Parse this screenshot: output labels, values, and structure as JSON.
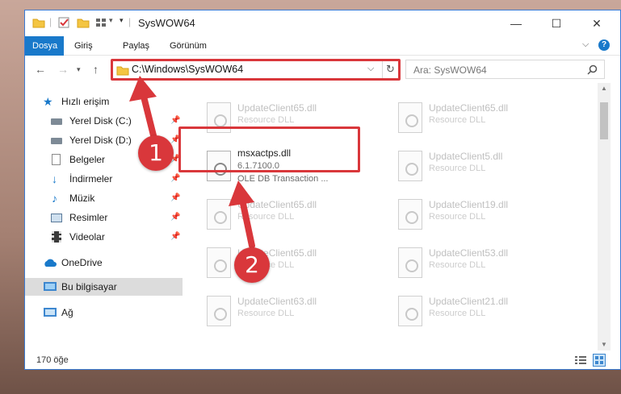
{
  "window": {
    "title": "SysWOW64",
    "controls": {
      "minimize": "—",
      "maximize": "☐",
      "close": "✕"
    }
  },
  "ribbon": {
    "tabs": [
      {
        "label": "Dosya",
        "active": true
      },
      {
        "label": "Giriş",
        "active": false
      },
      {
        "label": "Paylaş",
        "active": false
      },
      {
        "label": "Görünüm",
        "active": false
      }
    ]
  },
  "nav": {
    "address": "C:\\Windows\\SysWOW64",
    "search_placeholder": "Ara: SysWOW64"
  },
  "sidebar": {
    "items": [
      {
        "label": "Hızlı erişim",
        "icon": "star-icon"
      },
      {
        "label": "Yerel Disk (C:)",
        "icon": "drive-icon",
        "pinned": true
      },
      {
        "label": "Yerel Disk (D:)",
        "icon": "drive-icon",
        "pinned": true
      },
      {
        "label": "Belgeler",
        "icon": "documents-icon",
        "pinned": true
      },
      {
        "label": "İndirmeler",
        "icon": "download-icon",
        "pinned": true
      },
      {
        "label": "Müzik",
        "icon": "music-icon",
        "pinned": true
      },
      {
        "label": "Resimler",
        "icon": "pictures-icon",
        "pinned": true
      },
      {
        "label": "Videolar",
        "icon": "video-icon",
        "pinned": true
      },
      {
        "label": "OneDrive",
        "icon": "cloud-icon"
      },
      {
        "label": "Bu bilgisayar",
        "icon": "computer-icon",
        "selected": true
      },
      {
        "label": "Ağ",
        "icon": "network-icon"
      }
    ]
  },
  "files": {
    "left": [
      {
        "name": "UpdateClient65.dll",
        "sub": "Resource DLL"
      },
      {
        "name": "msxactps.dll",
        "version": "6.1.7100.0",
        "sub": "OLE DB Transaction ...",
        "highlight": true
      },
      {
        "name": "UpdateClient65.dll",
        "sub": "Resource DLL"
      },
      {
        "name": "UpdateClient65.dll",
        "sub": "Resource DLL"
      },
      {
        "name": "UpdateClient63.dll",
        "sub": "Resource DLL"
      }
    ],
    "right": [
      {
        "name": "UpdateClient65.dll",
        "sub": "Resource DLL"
      },
      {
        "name": "UpdateClient5.dll",
        "sub": "Resource DLL"
      },
      {
        "name": "UpdateClient19.dll",
        "sub": "Resource DLL"
      },
      {
        "name": "UpdateClient53.dll",
        "sub": "Resource DLL"
      },
      {
        "name": "UpdateClient21.dll",
        "sub": "Resource DLL"
      }
    ]
  },
  "status": {
    "count": "170 öğe"
  },
  "markers": {
    "one": "1",
    "two": "2"
  },
  "colors": {
    "accent": "#1979ca",
    "highlight": "#d9373b"
  }
}
